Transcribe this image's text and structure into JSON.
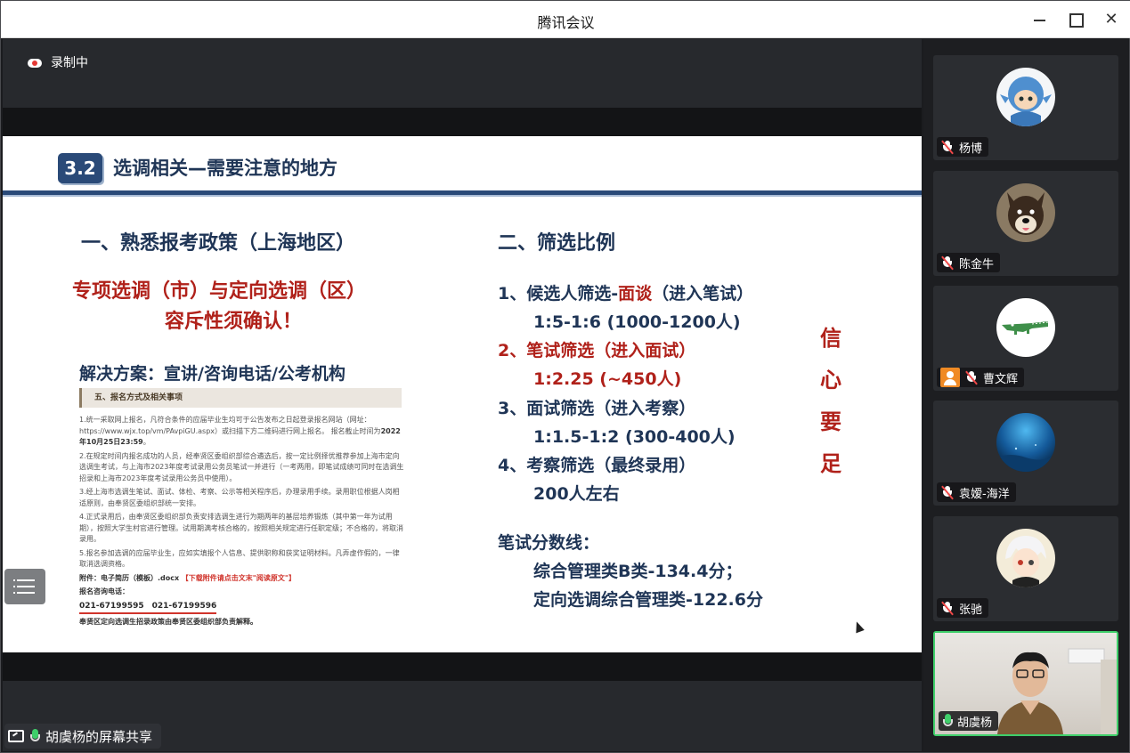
{
  "window": {
    "title": "腾讯会议"
  },
  "recording": {
    "label": "录制中"
  },
  "slide": {
    "number": "3.2",
    "title": "选调相关—需要注意的地方",
    "left": {
      "title": "一、熟悉报考政策（上海地区）",
      "red_line1": "专项选调（市）与定向选调（区）",
      "red_line2": "容斥性须确认！",
      "solution": "解决方案：宣讲/咨询电话/公考机构",
      "doc": {
        "header": "五、报名方式及相关事项",
        "p1": "1.统一采取网上报名，凡符合条件的应届毕业生均可于公告发布之日起登录报名网站（网址：https://www.wjx.top/vm/PAvpiGU.aspx）或扫描下方二维码进行网上报名。",
        "p1_deadline_prefix": "报名截止时间为",
        "p1_deadline": "2022年10月25日23:59",
        "p1_deadline_suffix": "。",
        "p2": "2.在规定时间内报名成功的人员，经奉贤区委组织部综合遴选后，按一定比例择优推荐参加上海市定向选调生考试，与上海市2023年度考试录用公务员笔试一并进行（一考两用，即笔试成绩可同时在选调生招录和上海市2023年度考试录用公务员中使用）。",
        "p3": "3.经上海市选调生笔试、面试、体检、考察、公示等相关程序后，办理录用手续。录用职位根据人岗相适原则，由奉贤区委组织部统一安排。",
        "p4": "4.正式录用后，由奉贤区委组织部负责安排选调生进行为期两年的基层培养锻炼（其中第一年为试用期），按照大学生村官进行管理。试用期满考核合格的，按照相关规定进行任职定级；不合格的，将取消录用。",
        "p5": "5.报名参加选调的应届毕业生，应如实填报个人信息、提供职称和获奖证明材料。凡弄虚作假的，一律取消选调资格。",
        "attachment": "附件：电子简历（模板）.docx",
        "attachment_note": "【下载附件请点击文末\"阅读原文\"】",
        "phone_label": "报名咨询电话：",
        "phones": "021-67199595　021-67199596",
        "footer": "奉贤区定向选调生招录政策由奉贤区委组织部负责解释。"
      }
    },
    "right": {
      "title": "二、筛选比例",
      "items": [
        {
          "prefix": "1、候选人筛选-",
          "highlight": "面谈",
          "suffix": "（进入笔试）",
          "detail": "1:5-1:6 (1000-1200人)"
        },
        {
          "prefix": "2、笔试筛选（进入面试）",
          "highlight": "",
          "suffix": "",
          "detail": "1:2.25 (~450人)"
        },
        {
          "prefix": "3、面试筛选（进入考察）",
          "highlight": "",
          "suffix": "",
          "detail": "1:1.5-1:2 (300-400人)"
        },
        {
          "prefix": "4、考察筛选（最终录用）",
          "highlight": "",
          "suffix": "",
          "detail": "200人左右"
        }
      ],
      "score_title": "笔试分数线：",
      "score1": "综合管理类B类-134.4分；",
      "score2": "定向选调综合管理类-122.6分"
    },
    "vertical_text": [
      "信",
      "心",
      "要",
      "足"
    ]
  },
  "sharer": {
    "label": "胡虞杨的屏幕共享"
  },
  "participants": [
    {
      "name": "杨博",
      "muted": true,
      "avatar": "cartoon-shark-avatar"
    },
    {
      "name": "陈金牛",
      "muted": true,
      "avatar": "shiba-dog-avatar"
    },
    {
      "name": "曹文辉",
      "muted": true,
      "avatar": "crocodile-avatar",
      "host_tag": true
    },
    {
      "name": "袁嫒-海洋",
      "muted": true,
      "avatar": "ocean-avatar"
    },
    {
      "name": "张驰",
      "muted": true,
      "avatar": "anime-boy-avatar"
    },
    {
      "name": "胡虞杨",
      "muted": false,
      "avatar": "camera-video",
      "active": true
    }
  ],
  "colors": {
    "accent_green": "#3fcf6a",
    "slide_navy": "#1f3556",
    "slide_red": "#b0211a"
  }
}
